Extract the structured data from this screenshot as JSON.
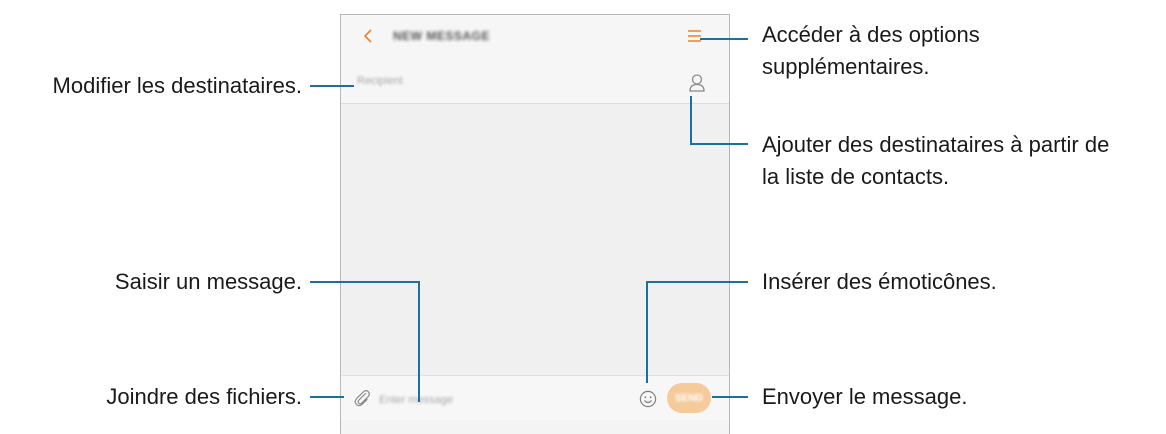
{
  "phone": {
    "header_title": "NEW MESSAGE",
    "recipient_placeholder": "Recipient",
    "message_placeholder": "Enter message",
    "send_label": "SEND",
    "accent_color": "#f07f2e",
    "send_button_color": "#f6cb9c",
    "icons": {
      "back": "chevron-left-icon",
      "more": "menu-icon",
      "contact": "person-icon",
      "attach": "paperclip-icon",
      "emoji": "smiley-icon"
    }
  },
  "callouts": {
    "edit_recipients": "Modifier les destinataires.",
    "more_options_line1": "Accéder à des options",
    "more_options_line2": "supplémentaires.",
    "add_from_contacts_line1": "Ajouter des destinataires à partir de",
    "add_from_contacts_line2": "la liste de contacts.",
    "enter_message": "Saisir un message.",
    "insert_emoticons": "Insérer des émoticônes.",
    "attach_files": "Joindre des fichiers.",
    "send_message": "Envoyer le message."
  },
  "leader_line_color": "#1e6ea0"
}
